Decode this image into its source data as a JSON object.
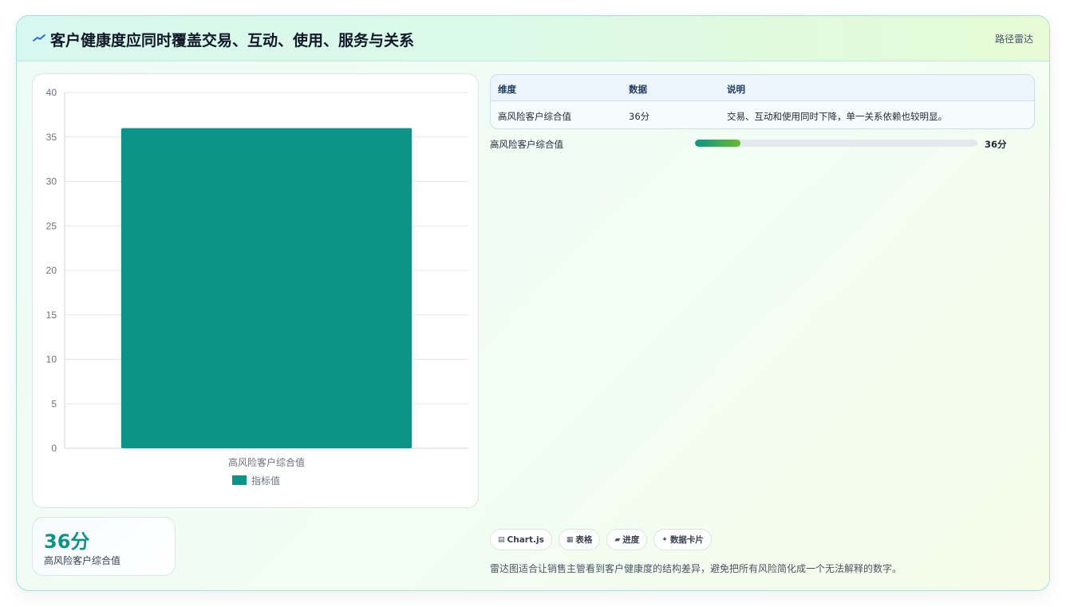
{
  "header": {
    "title": "客户健康度应同时覆盖交易、互动、使用、服务与关系",
    "icon": "trend-spark-icon",
    "path_link": "路径雷达"
  },
  "chart_data": {
    "type": "bar",
    "categories": [
      "高风险客户综合值"
    ],
    "series": [
      {
        "name": "指标值",
        "values": [
          36
        ],
        "color": "#0d9488"
      }
    ],
    "ylim": [
      0,
      40
    ],
    "yticks": [
      0,
      5,
      10,
      15,
      20,
      25,
      30,
      35,
      40
    ],
    "grid": true,
    "legend": "bottom"
  },
  "kpi": {
    "value": "36分",
    "label": "高风险客户综合值"
  },
  "table": {
    "headers": [
      "维度",
      "数据",
      "说明"
    ],
    "rows": [
      [
        "高风险客户综合值",
        "36分",
        "交易、互动和使用同时下降，单一关系依赖也较明显。"
      ]
    ]
  },
  "progress": {
    "label": "高风险客户综合值",
    "value_text": "36分",
    "fraction": 0.16
  },
  "chips": [
    {
      "icon": "▤",
      "label": "Chart.js"
    },
    {
      "icon": "▦",
      "label": "表格"
    },
    {
      "icon": "▰",
      "label": "进度"
    },
    {
      "icon": "✦",
      "label": "数据卡片"
    }
  ],
  "footnote": "雷达图适合让销售主管看到客户健康度的结构差异，避免把所有风险简化成一个无法解释的数字。"
}
